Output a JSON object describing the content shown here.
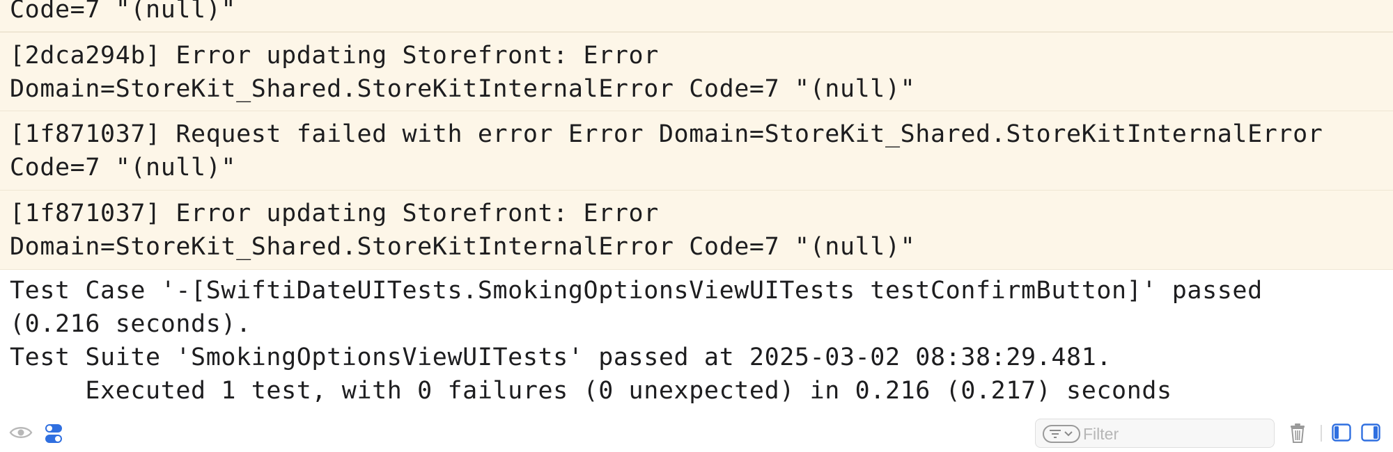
{
  "console": {
    "entries": [
      {
        "kind": "warning",
        "lines": [
          "Code=7 \"(null)\""
        ]
      },
      {
        "kind": "warning",
        "lines": [
          "[2dca294b] Error updating Storefront: Error",
          "Domain=StoreKit_Shared.StoreKitInternalError Code=7 \"(null)\""
        ]
      },
      {
        "kind": "warning",
        "lines": [
          "[1f871037] Request failed with error Error Domain=StoreKit_Shared.StoreKitInternalError",
          "Code=7 \"(null)\""
        ]
      },
      {
        "kind": "warning",
        "lines": [
          "[1f871037] Error updating Storefront: Error",
          "Domain=StoreKit_Shared.StoreKitInternalError Code=7 \"(null)\""
        ]
      },
      {
        "kind": "plain",
        "lines": [
          "Test Case '-[SwiftiDateUITests.SmokingOptionsViewUITests testConfirmButton]' passed",
          "(0.216 seconds).",
          "Test Suite 'SmokingOptionsViewUITests' passed at 2025-03-02 08:38:29.481.",
          "     Executed 1 test, with 0 failures (0 unexpected) in 0.216 (0.217) seconds"
        ]
      }
    ]
  },
  "toolbar": {
    "visibility_icon": "eye-icon",
    "toggle_icon": "switches-icon",
    "filter_menu_icon": "filter-lines-chevron-icon",
    "filter_placeholder": "Filter",
    "filter_value": "",
    "trash_icon": "trash-icon",
    "left_panel_icon": "left-panel-icon",
    "right_panel_icon": "right-panel-icon"
  },
  "colors": {
    "warning_background": "#fdf6e8",
    "warning_border": "#efe6d3",
    "text": "#1d1d1f",
    "accent": "#2f6fe0",
    "icon_gray": "#9a9a9a"
  }
}
